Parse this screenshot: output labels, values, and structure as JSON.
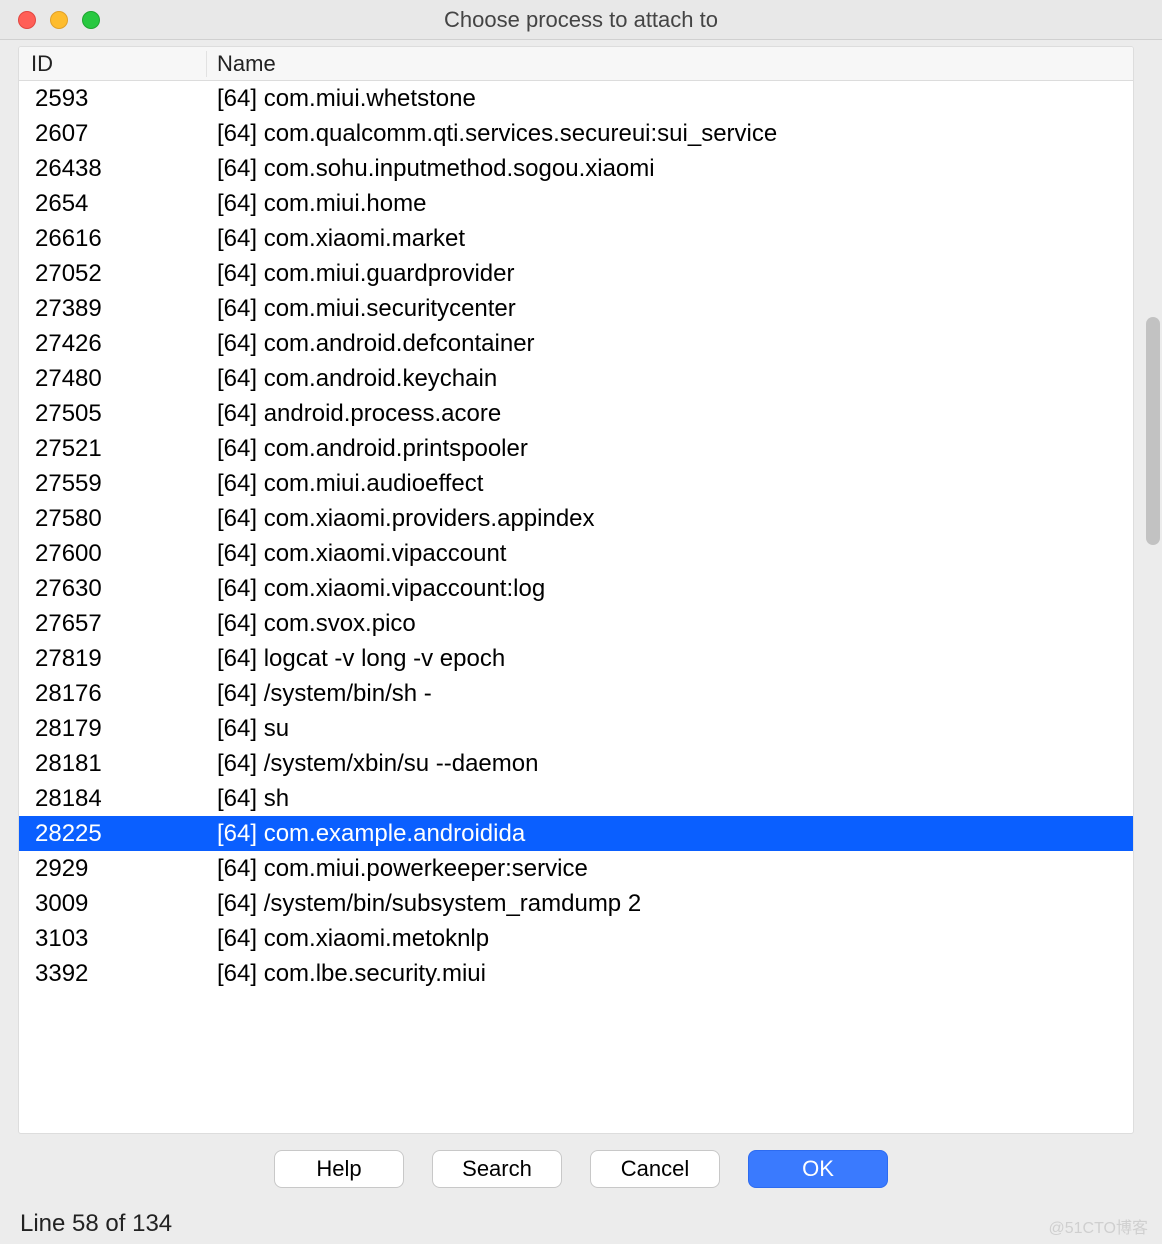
{
  "window": {
    "title": "Choose process to attach to"
  },
  "columns": {
    "id": "ID",
    "name": "Name"
  },
  "processes": [
    {
      "id": "2593",
      "name": "[64] com.miui.whetstone"
    },
    {
      "id": "2607",
      "name": "[64] com.qualcomm.qti.services.secureui:sui_service"
    },
    {
      "id": "26438",
      "name": "[64] com.sohu.inputmethod.sogou.xiaomi"
    },
    {
      "id": "2654",
      "name": "[64] com.miui.home"
    },
    {
      "id": "26616",
      "name": "[64] com.xiaomi.market"
    },
    {
      "id": "27052",
      "name": "[64] com.miui.guardprovider"
    },
    {
      "id": "27389",
      "name": "[64] com.miui.securitycenter"
    },
    {
      "id": "27426",
      "name": "[64] com.android.defcontainer"
    },
    {
      "id": "27480",
      "name": "[64] com.android.keychain"
    },
    {
      "id": "27505",
      "name": "[64] android.process.acore"
    },
    {
      "id": "27521",
      "name": "[64] com.android.printspooler"
    },
    {
      "id": "27559",
      "name": "[64] com.miui.audioeffect"
    },
    {
      "id": "27580",
      "name": "[64] com.xiaomi.providers.appindex"
    },
    {
      "id": "27600",
      "name": "[64] com.xiaomi.vipaccount"
    },
    {
      "id": "27630",
      "name": "[64] com.xiaomi.vipaccount:log"
    },
    {
      "id": "27657",
      "name": "[64] com.svox.pico"
    },
    {
      "id": "27819",
      "name": "[64] logcat -v long -v epoch"
    },
    {
      "id": "28176",
      "name": "[64] /system/bin/sh -"
    },
    {
      "id": "28179",
      "name": "[64] su"
    },
    {
      "id": "28181",
      "name": "[64] /system/xbin/su --daemon"
    },
    {
      "id": "28184",
      "name": "[64] sh"
    },
    {
      "id": "28225",
      "name": "[64] com.example.androidida",
      "selected": true
    },
    {
      "id": "2929",
      "name": "[64] com.miui.powerkeeper:service"
    },
    {
      "id": "3009",
      "name": "[64] /system/bin/subsystem_ramdump 2"
    },
    {
      "id": "3103",
      "name": "[64] com.xiaomi.metoknlp"
    },
    {
      "id": "3392",
      "name": "[64] com.lbe.security.miui"
    }
  ],
  "buttons": {
    "help": "Help",
    "search": "Search",
    "cancel": "Cancel",
    "ok": "OK"
  },
  "status": "Line 58 of 134",
  "watermark": "@51CTO博客",
  "scrollbar": {
    "top_pct": 22,
    "height_pct": 22
  }
}
